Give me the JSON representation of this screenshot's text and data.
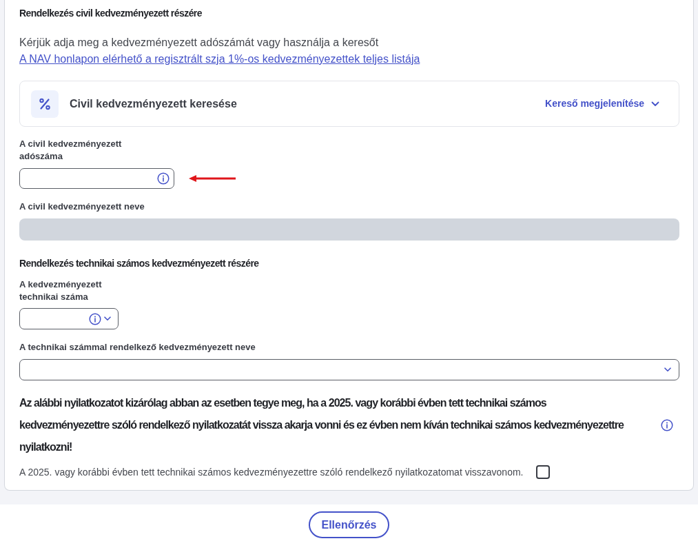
{
  "civil_section": {
    "heading": "Rendelkezés civil kedvezményezett részére",
    "intro": "Kérjük adja meg a kedvezményezett adószámát vagy használja a keresőt",
    "link": "A NAV honlapon elérhető a regisztrált szja 1%-os kedvezményezettek teljes listája",
    "search_panel": {
      "title": "Civil kedvezményezett keresése",
      "toggle": "Kereső megjelenítése",
      "expanded": false
    },
    "tax_number_field": {
      "label": "A civil kedvezményezett adószáma"
    },
    "name_field": {
      "label": "A civil kedvezményezett neve",
      "disabled": true
    }
  },
  "technical_section": {
    "heading": "Rendelkezés technikai számos kedvezményezett részére",
    "number_field": {
      "label": "A kedvezményezett technikai száma"
    },
    "name_field": {
      "label": "A technikai számmal rendelkező kedvezményezett neve"
    }
  },
  "withdrawal": {
    "notice": "Az alábbi nyilatkozatot kizárólag abban az esetben tegye meg, ha a 2025. vagy korábbi évben tett technikai számos kedvezményezettre szóló rendelkező nyilatkozatát vissza akarja vonni és ez évben nem kíván technikai számos kedvezményezettre nyilatkozni!",
    "checkbox": {
      "label": "A 2025. vagy korábbi évben tett technikai számos kedvezményezettre szóló rendelkező nyilatkozatomat visszavonom.",
      "checked": false
    }
  },
  "check_button": {
    "label": "Ellenőrzés"
  }
}
